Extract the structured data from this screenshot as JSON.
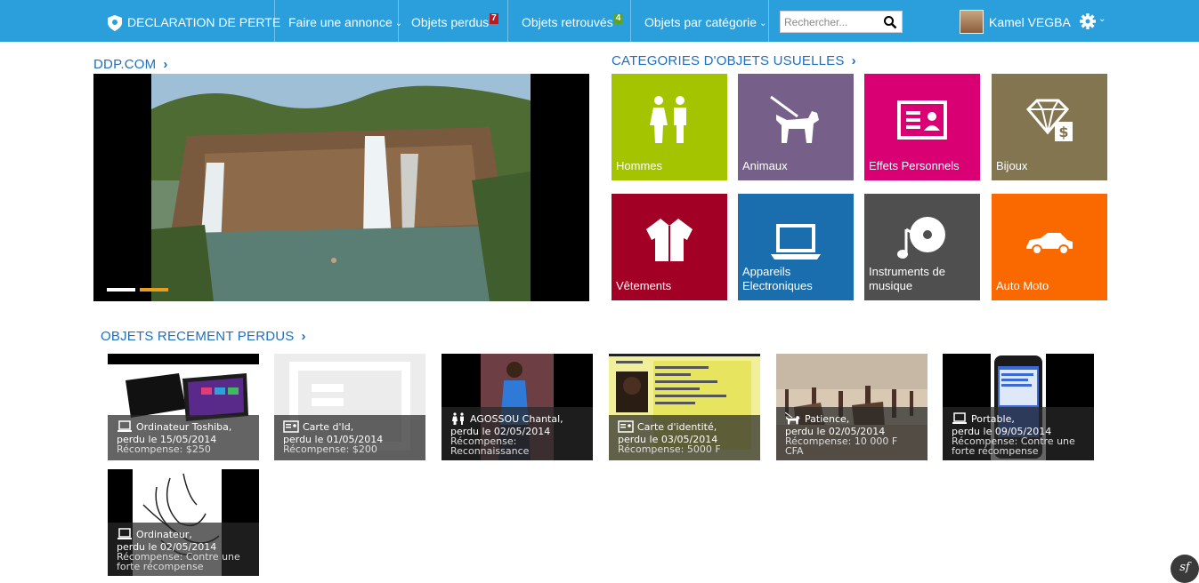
{
  "nav": {
    "brand": "DECLARATION DE PERTE",
    "post_ad": "Faire une annonce",
    "lost_items": "Objets perdus",
    "lost_count": "7",
    "found_items": "Objets retrouvés",
    "found_count": "4",
    "by_category": "Objets par catégorie",
    "search_placeholder": "Rechercher...",
    "user_name": "Kamel VEGBA"
  },
  "slider": {
    "title": "DDP.COM",
    "active_slide": 2,
    "slide_count": 2
  },
  "categories": {
    "title": "CATEGORIES D'OBJETS USUELLES",
    "tiles": [
      {
        "label": "Hommes",
        "icon": "people-icon",
        "color": "#a4c400"
      },
      {
        "label": "Animaux",
        "icon": "dog-icon",
        "color": "#76608a"
      },
      {
        "label": "Effets Personnels",
        "icon": "id-card-icon",
        "color": "#d80073"
      },
      {
        "label": "Bijoux",
        "icon": "diamond-icon",
        "color": "#82754f"
      },
      {
        "label": "Vêtements",
        "icon": "shirt-icon",
        "color": "#a20025"
      },
      {
        "label": "Appareils Electroniques",
        "icon": "laptop-icon",
        "color": "#1b6eae"
      },
      {
        "label": "Instruments de musique",
        "icon": "music-disc-icon",
        "color": "#4f4f4f"
      },
      {
        "label": "Auto Moto",
        "icon": "car-icon",
        "color": "#fa6800"
      }
    ]
  },
  "recent": {
    "title": "OBJETS RECEMENT PERDUS",
    "items": [
      {
        "name": "Ordinateur Toshiba,",
        "date": "perdu le 15/05/2014",
        "reward": "Récompense: $250",
        "icon": "laptop-icon"
      },
      {
        "name": "Carte d'Id,",
        "date": "perdu le 01/05/2014",
        "reward": "Récompense: $200",
        "icon": "id-card-icon"
      },
      {
        "name": "AGOSSOU Chantal,",
        "date": "perdu le 02/05/2014",
        "reward": "Récompense:",
        "reward2": "Reconnaissance",
        "icon": "people-icon"
      },
      {
        "name": "Carte d'identité,",
        "date": "perdu le 03/05/2014",
        "reward": "Récompense: 5000 F",
        "icon": "id-card-icon"
      },
      {
        "name": "Patience,",
        "date": "perdu le 02/05/2014",
        "reward": "Récompense: 10 000 F",
        "reward2": "CFA",
        "icon": "dog-icon"
      },
      {
        "name": "Portable,",
        "date": "perdu le 09/05/2014",
        "reward": "Récompense: Contre une",
        "reward2": "forte récompense",
        "icon": "laptop-icon"
      },
      {
        "name": "Ordinateur,",
        "date": "perdu le 02/05/2014",
        "reward": "Récompense: Contre une",
        "reward2": "forte récompense",
        "icon": "laptop-icon"
      }
    ]
  },
  "footer": {
    "symfony_badge": "sf"
  }
}
